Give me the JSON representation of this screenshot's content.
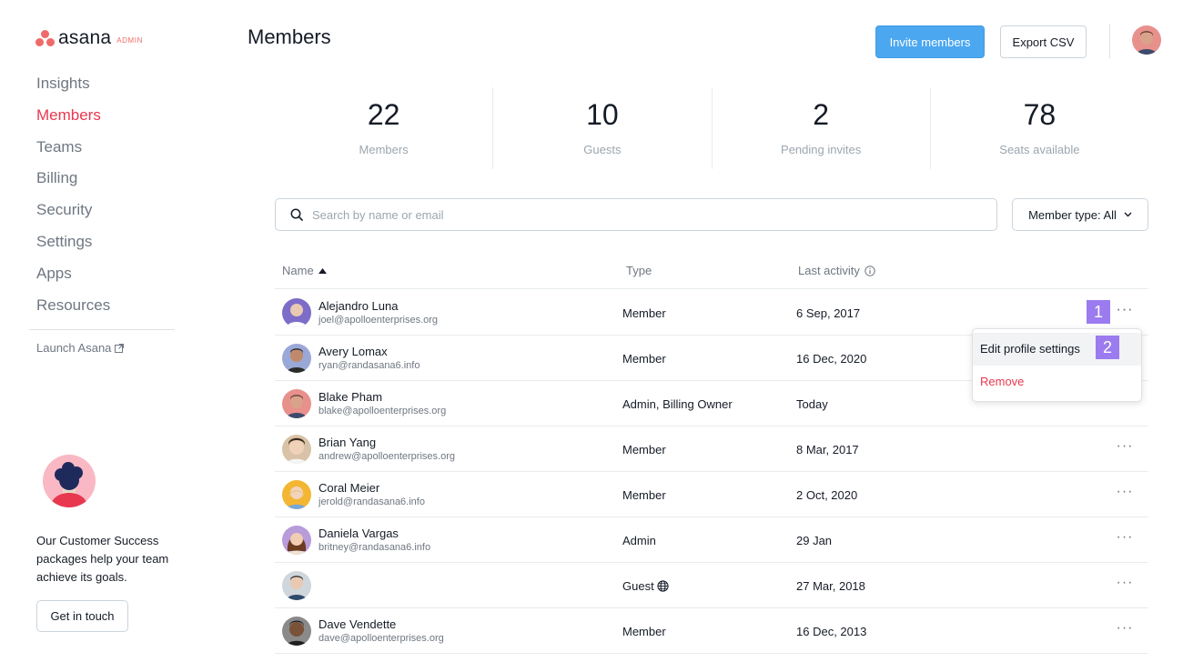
{
  "brand": {
    "name": "asana",
    "badge": "ADMIN",
    "accent": "#f06a6a"
  },
  "sidebar": {
    "items": [
      {
        "label": "Insights",
        "active": false
      },
      {
        "label": "Members",
        "active": true
      },
      {
        "label": "Teams",
        "active": false
      },
      {
        "label": "Billing",
        "active": false
      },
      {
        "label": "Security",
        "active": false
      },
      {
        "label": "Settings",
        "active": false
      },
      {
        "label": "Apps",
        "active": false
      },
      {
        "label": "Resources",
        "active": false
      }
    ],
    "launch_label": "Launch Asana",
    "promo_text": "Our Customer Success packages help your team achieve its goals.",
    "promo_button": "Get in touch"
  },
  "header": {
    "title": "Members",
    "invite_label": "Invite members",
    "export_label": "Export CSV"
  },
  "stats": [
    {
      "value": "22",
      "label": "Members"
    },
    {
      "value": "10",
      "label": "Guests"
    },
    {
      "value": "2",
      "label": "Pending invites"
    },
    {
      "value": "78",
      "label": "Seats available"
    }
  ],
  "search": {
    "placeholder": "Search by name or email",
    "value": ""
  },
  "filter": {
    "label": "Member type: All"
  },
  "table": {
    "columns": {
      "name": "Name",
      "type": "Type",
      "activity": "Last activity"
    },
    "rows": [
      {
        "name": "Alejandro Luna",
        "email": "joel@apolloenterprises.org",
        "type": "Member",
        "activity": "6 Sep, 2017",
        "avatar_color": "#7d6cc8",
        "guest": false
      },
      {
        "name": "Avery Lomax",
        "email": "ryan@randasana6.info",
        "type": "Member",
        "activity": "16 Dec, 2020",
        "avatar_color": "#9aa8d8",
        "guest": false
      },
      {
        "name": "Blake Pham",
        "email": "blake@apolloenterprises.org",
        "type": "Admin, Billing Owner",
        "activity": "Today",
        "avatar_color": "#e8918c",
        "guest": false
      },
      {
        "name": "Brian Yang",
        "email": "andrew@apolloenterprises.org",
        "type": "Member",
        "activity": "8 Mar, 2017",
        "avatar_color": "#d9c3a8",
        "guest": false
      },
      {
        "name": "Coral Meier",
        "email": "jerold@randasana6.info",
        "type": "Member",
        "activity": "2 Oct, 2020",
        "avatar_color": "#f2b632",
        "guest": false
      },
      {
        "name": "Daniela Vargas",
        "email": "britney@randasana6.info",
        "type": "Admin",
        "activity": "29 Jan",
        "avatar_color": "#b89bd9",
        "guest": false
      },
      {
        "name": "",
        "email": "",
        "type": "Guest",
        "activity": "27 Mar, 2018",
        "avatar_color": "#cfd6dc",
        "guest": true
      },
      {
        "name": "Dave Vendette",
        "email": "dave@apolloenterprises.org",
        "type": "Member",
        "activity": "16 Dec, 2013",
        "avatar_color": "#8a8a8a",
        "guest": false
      }
    ]
  },
  "menu": {
    "edit_label": "Edit profile settings",
    "remove_label": "Remove"
  },
  "callouts": [
    "1",
    "2"
  ]
}
